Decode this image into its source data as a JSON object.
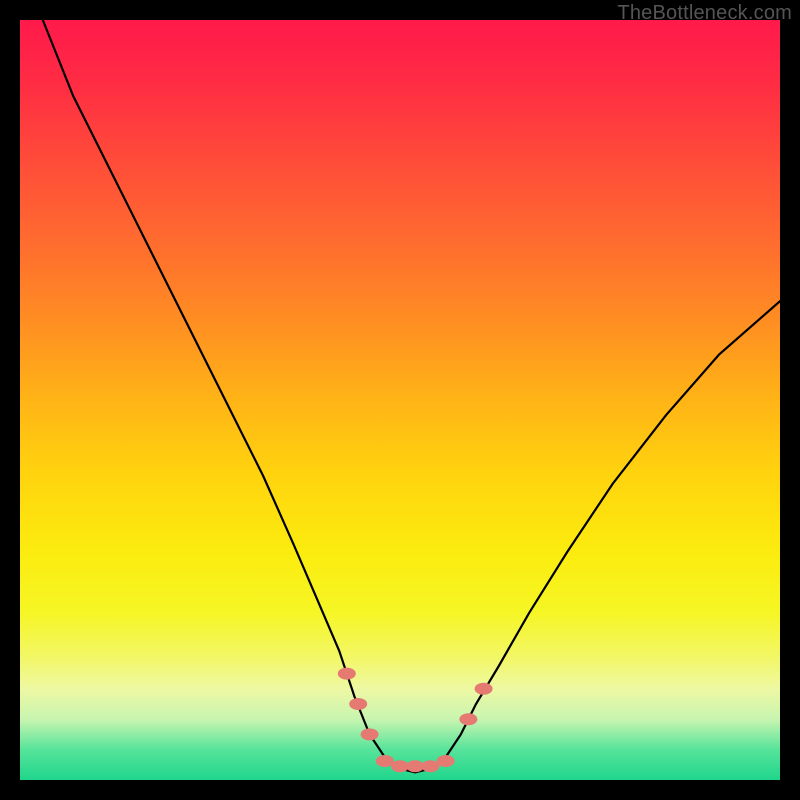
{
  "watermark": "TheBottleneck.com",
  "colors": {
    "background": "#000000",
    "gradient_top": "#ff1a4b",
    "gradient_bottom": "#1fd68c",
    "curve": "#000000",
    "marker": "#e57a73"
  },
  "chart_data": {
    "type": "line",
    "title": "",
    "xlabel": "",
    "ylabel": "",
    "xlim": [
      0,
      100
    ],
    "ylim": [
      0,
      100
    ],
    "note": "No axis ticks or numeric labels shown; values are normalized 0–100 percentages read from pixel positions. y is visual height from bottom.",
    "series": [
      {
        "name": "bottleneck-curve",
        "x": [
          3,
          7,
          12,
          17,
          22,
          27,
          32,
          36,
          39,
          42,
          44,
          46,
          48,
          50,
          52,
          54,
          56,
          58,
          60,
          63,
          67,
          72,
          78,
          85,
          92,
          100
        ],
        "y": [
          100,
          90,
          80,
          70,
          60,
          50,
          40,
          31,
          24,
          17,
          11,
          6,
          3,
          1.5,
          1,
          1.5,
          3,
          6,
          10,
          15,
          22,
          30,
          39,
          48,
          56,
          63
        ]
      }
    ],
    "markers": {
      "name": "highlight-dots",
      "note": "Small salmon lozenge markers clustered near bottom of the V",
      "points": [
        {
          "x": 43.0,
          "y": 14.0
        },
        {
          "x": 44.5,
          "y": 10.0
        },
        {
          "x": 46.0,
          "y": 6.0
        },
        {
          "x": 48.0,
          "y": 2.5
        },
        {
          "x": 50.0,
          "y": 1.8
        },
        {
          "x": 52.0,
          "y": 1.8
        },
        {
          "x": 54.0,
          "y": 1.8
        },
        {
          "x": 56.0,
          "y": 2.5
        },
        {
          "x": 59.0,
          "y": 8.0
        },
        {
          "x": 61.0,
          "y": 12.0
        }
      ]
    }
  }
}
